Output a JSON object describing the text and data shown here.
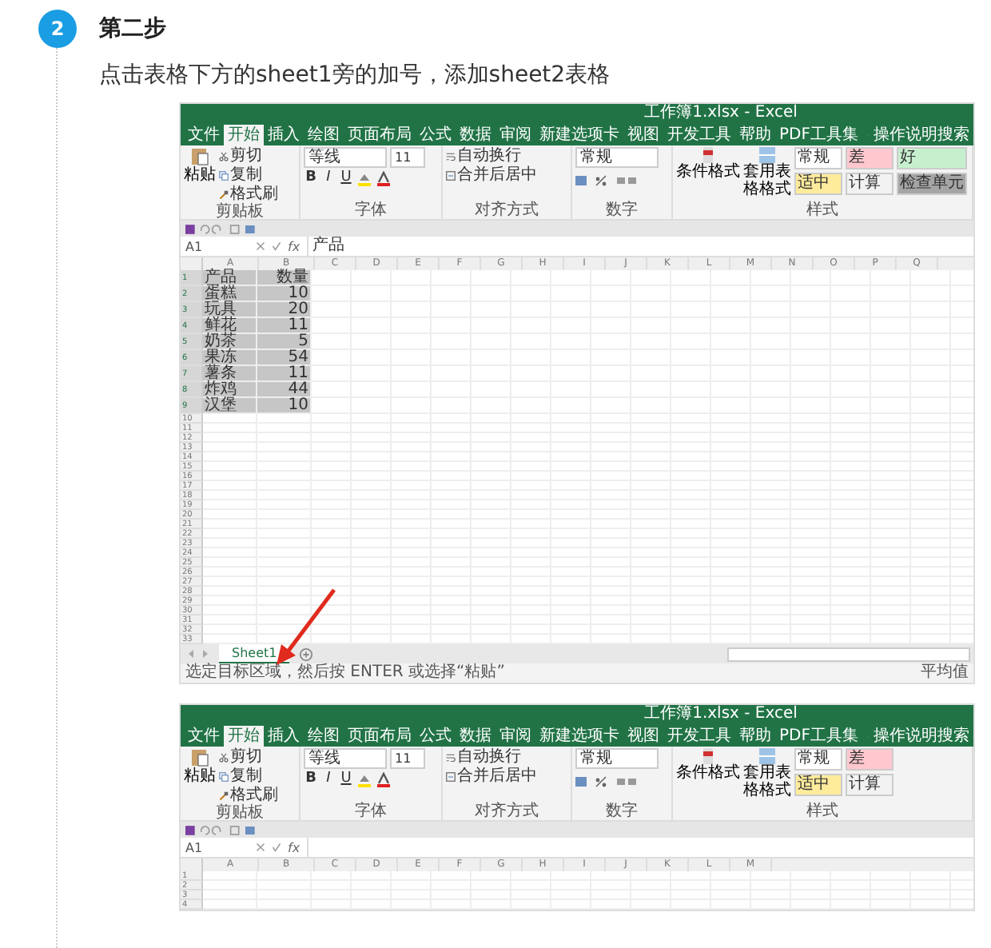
{
  "step": {
    "number": "2",
    "title": "第二步",
    "text": "点击表格下方的sheet1旁的加号，添加sheet2表格"
  },
  "screenshots": [
    {
      "window_title": "工作簿1.xlsx - Excel",
      "tabs": [
        {
          "label": "文件",
          "selected": false
        },
        {
          "label": "开始",
          "selected": true
        },
        {
          "label": "插入",
          "selected": false
        },
        {
          "label": "绘图",
          "selected": false
        },
        {
          "label": "页面布局",
          "selected": false
        },
        {
          "label": "公式",
          "selected": false
        },
        {
          "label": "数据",
          "selected": false
        },
        {
          "label": "审阅",
          "selected": false
        },
        {
          "label": "新建选项卡",
          "selected": false
        },
        {
          "label": "视图",
          "selected": false
        },
        {
          "label": "开发工具",
          "selected": false
        },
        {
          "label": "帮助",
          "selected": false
        },
        {
          "label": "PDF工具集",
          "selected": false
        }
      ],
      "search": "操作说明搜索",
      "ribbon": {
        "paste": "粘贴",
        "cut": "剪切",
        "copy": "复制",
        "painter": "格式刷",
        "clipboard_label": "剪贴板",
        "font_name": "等线",
        "font_size": "11",
        "font_buttons": [
          "B",
          "I",
          "U"
        ],
        "font_label": "字体",
        "wrap": "自动换行",
        "merge": "合并后居中",
        "alignment_label": "对齐方式",
        "number_format": "常规",
        "number_label": "数字",
        "conditional": "条件格式",
        "table_format": "套用表格格式",
        "styles_label": "样式",
        "styles": [
          {
            "label": "常规",
            "color": "#ffffff"
          },
          {
            "label": "差",
            "color": "#ffc7ce"
          },
          {
            "label": "好",
            "color": "#c6efce"
          },
          {
            "label": "适中",
            "color": "#ffeb9c"
          },
          {
            "label": "计算",
            "color": "#f2f2f2"
          },
          {
            "label": "检查单元",
            "color": "#a5a5a5"
          }
        ]
      },
      "name_box": "A1",
      "function_label": "fx",
      "formula": "产品",
      "columns": [
        "A",
        "B",
        "C",
        "D",
        "E",
        "F",
        "G",
        "H",
        "I",
        "J",
        "K",
        "L",
        "M",
        "N",
        "O",
        "P",
        "Q"
      ],
      "rows": [
        {
          "number": "1",
          "cells": [
            "产品",
            "数量"
          ],
          "selected": true
        },
        {
          "number": "2",
          "cells": [
            "蛋糕",
            "10"
          ],
          "selected": true
        },
        {
          "number": "3",
          "cells": [
            "玩具",
            "20"
          ],
          "selected": true
        },
        {
          "number": "4",
          "cells": [
            "鲜花",
            "11"
          ],
          "selected": true
        },
        {
          "number": "5",
          "cells": [
            "奶茶",
            "5"
          ],
          "selected": true
        },
        {
          "number": "6",
          "cells": [
            "果冻",
            "54"
          ],
          "selected": true
        },
        {
          "number": "7",
          "cells": [
            "薯条",
            "11"
          ],
          "selected": true
        },
        {
          "number": "8",
          "cells": [
            "炸鸡",
            "44"
          ],
          "selected": true
        },
        {
          "number": "9",
          "cells": [
            "汉堡",
            "10"
          ],
          "selected": true
        },
        {
          "number": "10",
          "cells": [],
          "selected": false
        },
        {
          "number": "11",
          "cells": [],
          "selected": false
        },
        {
          "number": "12",
          "cells": [],
          "selected": false
        },
        {
          "number": "13",
          "cells": [],
          "selected": false
        },
        {
          "number": "14",
          "cells": [],
          "selected": false
        },
        {
          "number": "15",
          "cells": [],
          "selected": false
        },
        {
          "number": "16",
          "cells": [],
          "selected": false
        },
        {
          "number": "17",
          "cells": [],
          "selected": false
        },
        {
          "number": "18",
          "cells": [],
          "selected": false
        },
        {
          "number": "19",
          "cells": [],
          "selected": false
        },
        {
          "number": "20",
          "cells": [],
          "selected": false
        },
        {
          "number": "21",
          "cells": [],
          "selected": false
        },
        {
          "number": "22",
          "cells": [],
          "selected": false
        },
        {
          "number": "23",
          "cells": [],
          "selected": false
        },
        {
          "number": "24",
          "cells": [],
          "selected": false
        },
        {
          "number": "25",
          "cells": [],
          "selected": false
        },
        {
          "number": "26",
          "cells": [],
          "selected": false
        },
        {
          "number": "27",
          "cells": [],
          "selected": false
        },
        {
          "number": "28",
          "cells": [],
          "selected": false
        },
        {
          "number": "29",
          "cells": [],
          "selected": false
        },
        {
          "number": "30",
          "cells": [],
          "selected": false
        },
        {
          "number": "31",
          "cells": [],
          "selected": false
        },
        {
          "number": "32",
          "cells": [],
          "selected": false
        },
        {
          "number": "33",
          "cells": [],
          "selected": false
        }
      ],
      "sheet_tabs": [
        {
          "label": "Sheet1",
          "selected": true
        }
      ],
      "status_text": "选定目标区域，然后按 ENTER 或选择“粘贴”",
      "status_right": "平均值"
    },
    {
      "window_title": "工作簿1.xlsx - Excel",
      "tabs": [
        {
          "label": "文件",
          "selected": false
        },
        {
          "label": "开始",
          "selected": true
        },
        {
          "label": "插入",
          "selected": false
        },
        {
          "label": "绘图",
          "selected": false
        },
        {
          "label": "页面布局",
          "selected": false
        },
        {
          "label": "公式",
          "selected": false
        },
        {
          "label": "数据",
          "selected": false
        },
        {
          "label": "审阅",
          "selected": false
        },
        {
          "label": "新建选项卡",
          "selected": false
        },
        {
          "label": "视图",
          "selected": false
        },
        {
          "label": "开发工具",
          "selected": false
        },
        {
          "label": "帮助",
          "selected": false
        },
        {
          "label": "PDF工具集",
          "selected": false
        }
      ],
      "search": "操作说明搜索",
      "ribbon": {
        "paste": "粘贴",
        "cut": "剪切",
        "copy": "复制",
        "painter": "格式刷",
        "clipboard_label": "剪贴板",
        "font_name": "等线",
        "font_size": "11",
        "font_buttons": [
          "B",
          "I",
          "U"
        ],
        "font_label": "字体",
        "wrap": "自动换行",
        "merge": "合并后居中",
        "alignment_label": "对齐方式",
        "number_format": "常规",
        "number_label": "数字",
        "conditional": "条件格式",
        "table_format": "套用表格格式",
        "styles_label": "样式",
        "styles": [
          {
            "label": "常规",
            "color": "#ffffff"
          },
          {
            "label": "差",
            "color": "#ffc7ce"
          },
          {
            "label": "适中",
            "color": "#ffeb9c"
          },
          {
            "label": "计算",
            "color": "#f2f2f2"
          }
        ]
      },
      "name_box": "A1",
      "function_label": "fx",
      "columns": [
        "A",
        "B",
        "C",
        "D",
        "E",
        "F",
        "G",
        "H",
        "I",
        "J",
        "K",
        "L",
        "M"
      ],
      "rows": [
        {
          "number": "1",
          "cells": [],
          "selected": false
        },
        {
          "number": "2",
          "cells": [],
          "selected": false
        },
        {
          "number": "3",
          "cells": [],
          "selected": false
        },
        {
          "number": "4",
          "cells": [],
          "selected": false
        }
      ]
    }
  ]
}
